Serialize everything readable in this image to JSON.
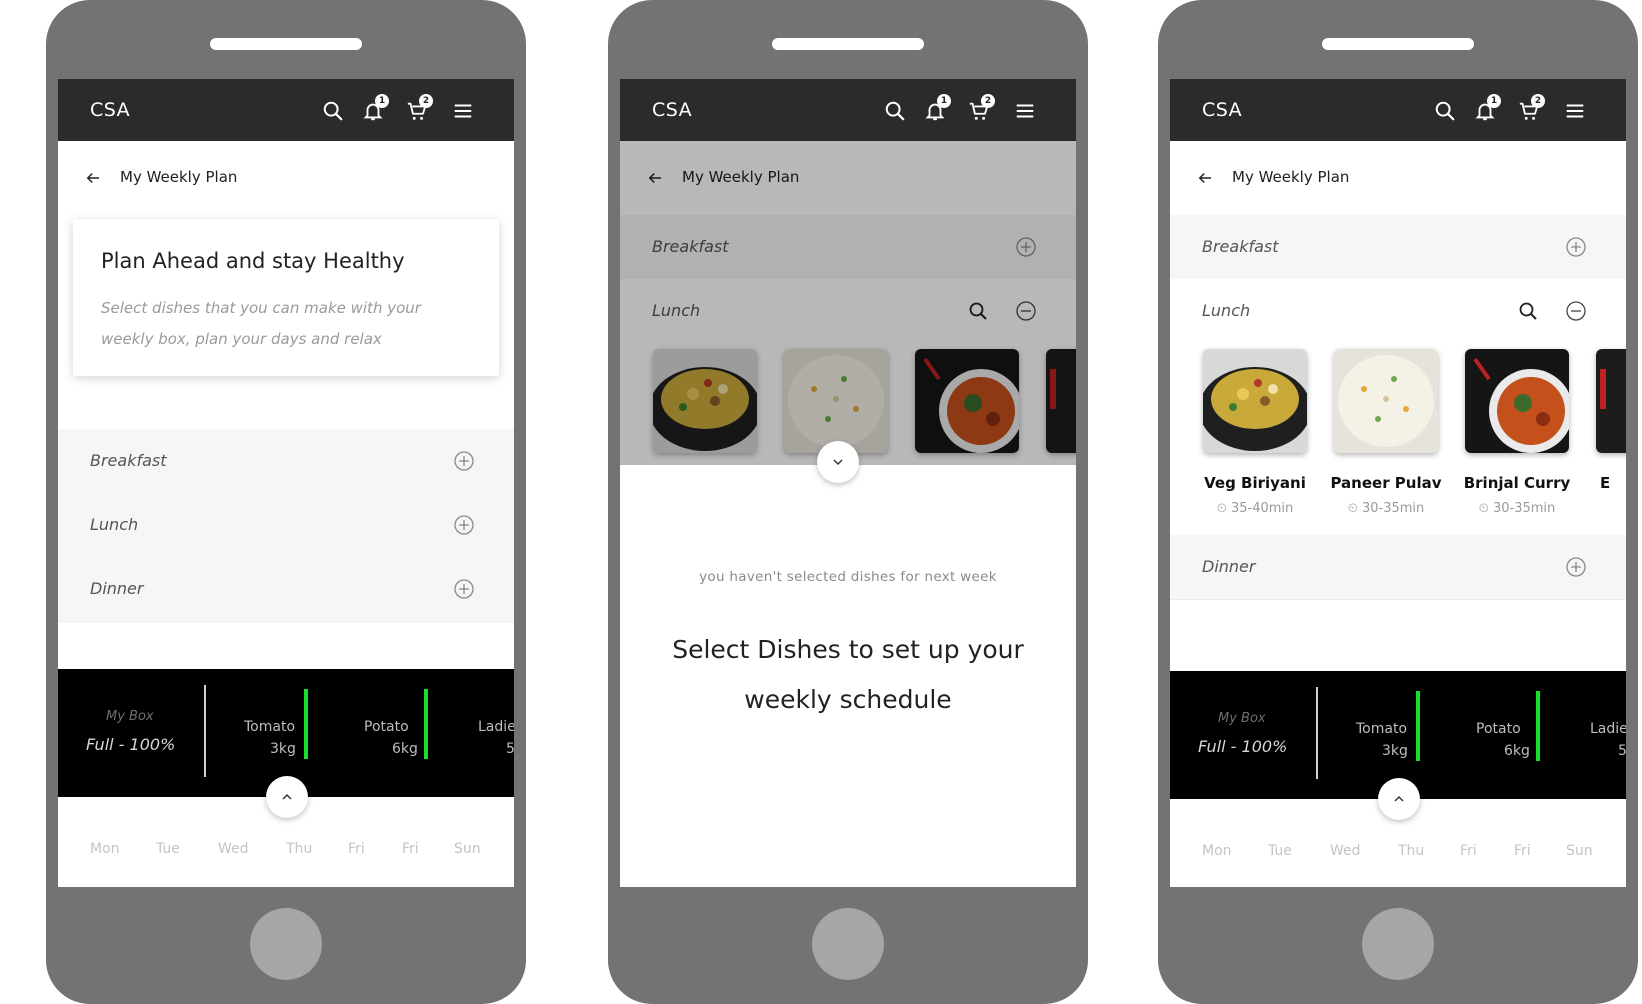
{
  "app": {
    "brand": "CSA",
    "notification_count": "1",
    "cart_count": "2"
  },
  "subheader": {
    "title": "My Weekly Plan"
  },
  "intro_card": {
    "title": "Plan Ahead and stay Healthy",
    "description": "Select dishes that you can make with your weekly box, plan your days and relax"
  },
  "meals": {
    "breakfast": "Breakfast",
    "lunch": "Lunch",
    "dinner": "Dinner"
  },
  "box": {
    "label": "My Box",
    "value": "Full - 100%",
    "items": [
      {
        "name": "Tomato",
        "qty": "3kg"
      },
      {
        "name": "Potato",
        "qty": "6kg"
      },
      {
        "name": "Ladie",
        "qty": "5"
      }
    ]
  },
  "days": [
    "Mon",
    "Tue",
    "Wed",
    "Thu",
    "Fri",
    "Fri",
    "Sun"
  ],
  "dishes": [
    {
      "name": "Veg Biriyani",
      "time": "35-40min"
    },
    {
      "name": "Paneer Pulav",
      "time": "30-35min"
    },
    {
      "name": "Brinjal Curry",
      "time": "30-35min"
    },
    {
      "name": "E",
      "time": ""
    }
  ],
  "empty_state": {
    "note": "you haven't selected dishes for next week",
    "headline": "Select Dishes to set up your weekly schedule"
  },
  "icons": {
    "search": "search-icon",
    "bell": "bell-icon",
    "cart": "cart-icon",
    "menu": "hamburger-menu-icon",
    "back": "back-arrow-icon",
    "plus": "plus-circle-icon",
    "minus": "minus-circle-icon",
    "chevron_up": "chevron-up-icon",
    "chevron_down": "chevron-down-icon",
    "clock": "timer-icon"
  },
  "colors": {
    "topbar": "#2b2b2b",
    "accent_green": "#1adf2b",
    "box_bg": "#000000",
    "phone_body": "#737373"
  }
}
